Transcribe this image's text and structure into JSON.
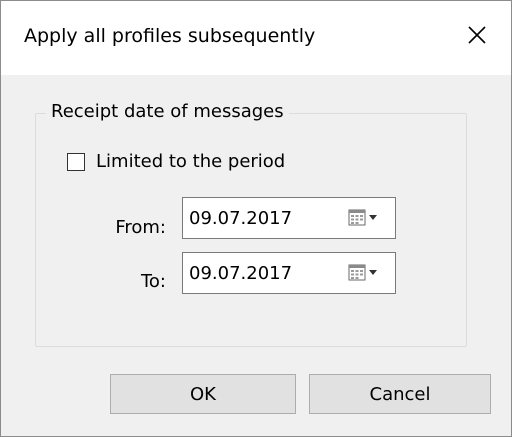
{
  "window": {
    "title": "Apply all profiles subsequently",
    "close_icon": "close-icon"
  },
  "group": {
    "label": "Receipt date of messages"
  },
  "limit_checkbox": {
    "label": "Limited to the period",
    "checked": false
  },
  "from_field": {
    "label": "From:",
    "value": "09.07.2017",
    "icon": "calendar-dropdown-icon"
  },
  "to_field": {
    "label": "To:",
    "value": "09.07.2017",
    "icon": "calendar-dropdown-icon"
  },
  "buttons": {
    "ok_label": "OK",
    "cancel_label": "Cancel"
  }
}
